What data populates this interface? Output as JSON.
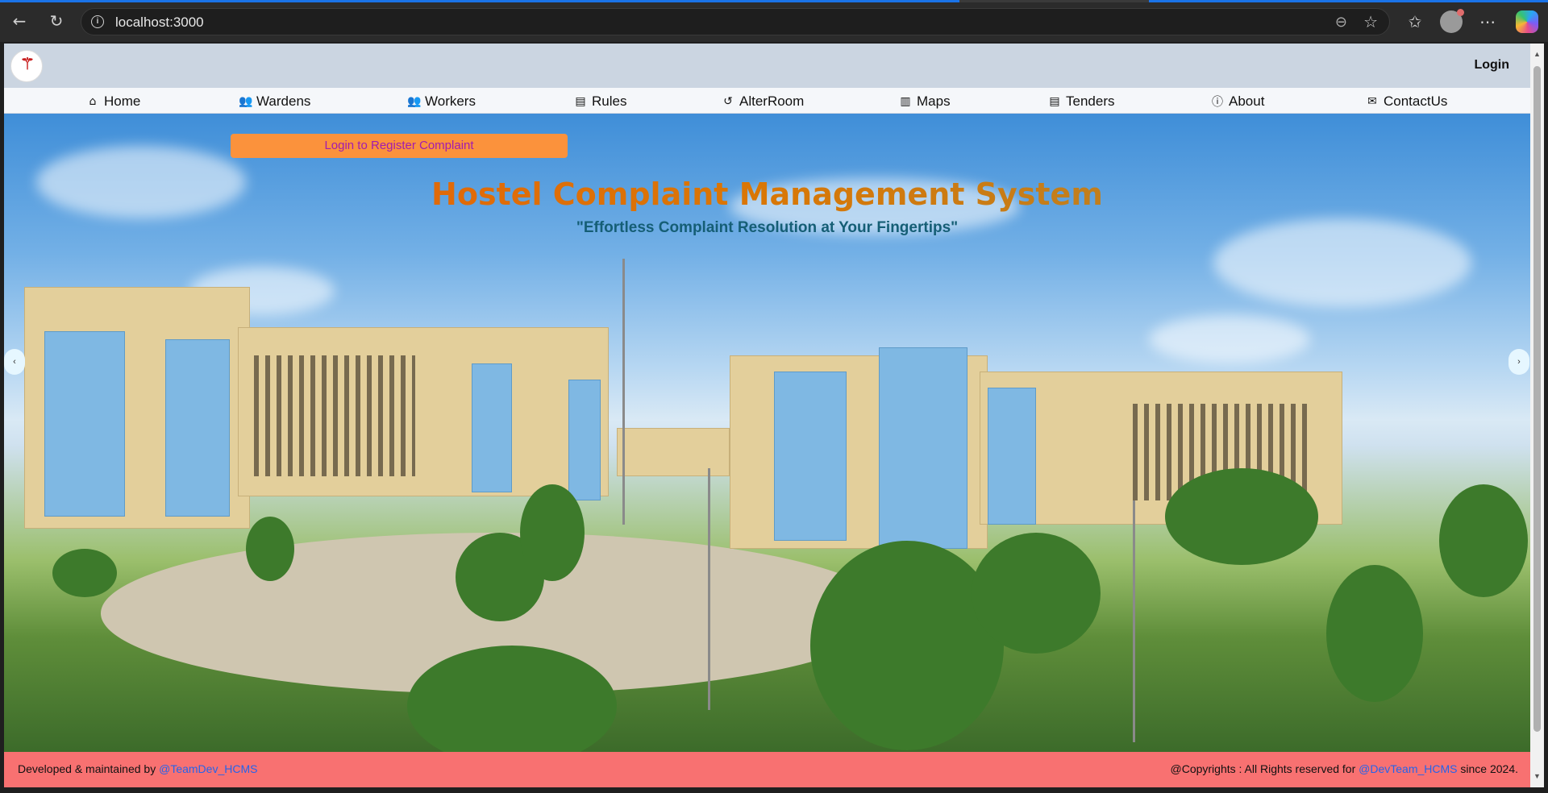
{
  "browser": {
    "url": "localhost:3000",
    "icons": [
      "back-icon",
      "refresh-icon",
      "info-icon",
      "zoom-icon",
      "star-icon",
      "favorites-icon",
      "profile-avatar",
      "more-icon",
      "copilot-icon"
    ]
  },
  "header": {
    "login_label": "Login"
  },
  "nav": {
    "items": [
      {
        "label": "Home",
        "icon": "home-icon",
        "glyph": "⌂"
      },
      {
        "label": "Wardens",
        "icon": "user-group-icon",
        "glyph": "👥"
      },
      {
        "label": "Workers",
        "icon": "users-icon",
        "glyph": "👥"
      },
      {
        "label": "Rules",
        "icon": "document-icon",
        "glyph": "▤"
      },
      {
        "label": "AlterRoom",
        "icon": "history-icon",
        "glyph": "↺"
      },
      {
        "label": "Maps",
        "icon": "map-icon",
        "glyph": "▥"
      },
      {
        "label": "Tenders",
        "icon": "file-text-icon",
        "glyph": "▤"
      },
      {
        "label": "About",
        "icon": "info-circle-icon",
        "glyph": "ⓘ"
      },
      {
        "label": "ContactUs",
        "icon": "mail-icon",
        "glyph": "✉"
      }
    ]
  },
  "hero": {
    "register_button": "Login to Register Complaint",
    "title": "Hostel Complaint Management System",
    "subtitle": "\"Effortless Complaint Resolution at Your Fingertips\"",
    "prev_arrow": "‹",
    "next_arrow": "›"
  },
  "footer": {
    "left_prefix": "Developed & maintained by ",
    "left_link": "@TeamDev_HCMS",
    "right_prefix": "@Copyrights : All Rights reserved for ",
    "right_link": "@DevTeam_HCMS",
    "right_suffix": " since 2024."
  },
  "colors": {
    "topbar": "#cbd5e1",
    "register_button": "#fb923c",
    "footer": "#f87171",
    "link": "#2563eb"
  }
}
